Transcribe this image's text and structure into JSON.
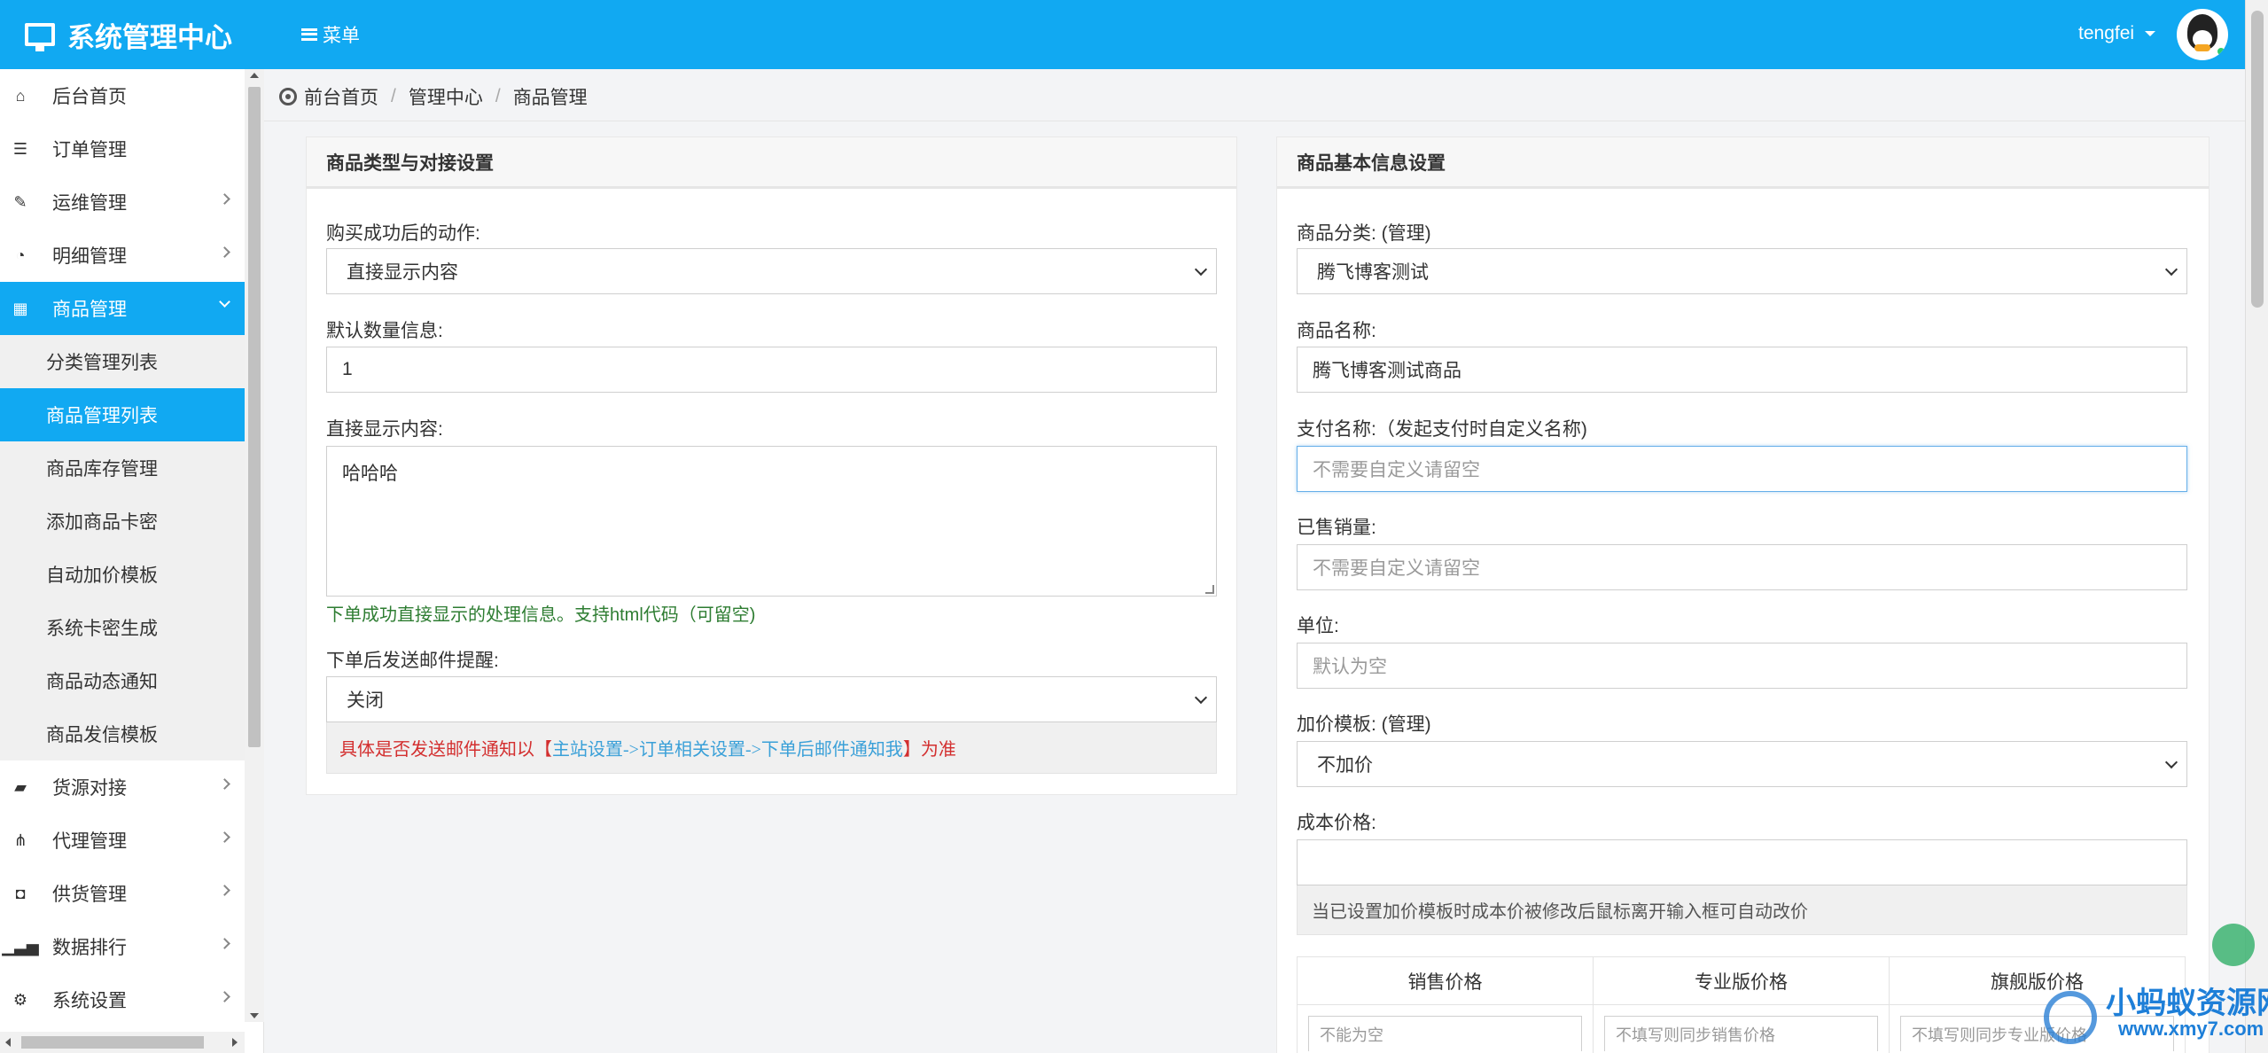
{
  "app": {
    "title": "系统管理中心",
    "menu_label": "菜单",
    "user": "tengfei"
  },
  "colors": {
    "primary": "#11a9f2",
    "help_green": "#2e7d32",
    "warn_red": "#d32f2f",
    "link_blue": "#3aa0d8"
  },
  "sidebar": {
    "items": [
      {
        "label": "后台首页",
        "icon": "home-icon"
      },
      {
        "label": "订单管理",
        "icon": "list-icon"
      },
      {
        "label": "运维管理",
        "icon": "comments-icon"
      },
      {
        "label": "明细管理",
        "icon": "pie-chart-icon"
      },
      {
        "label": "商品管理",
        "icon": "grid-icon"
      },
      {
        "label": "货源对接",
        "icon": "briefcase-icon"
      },
      {
        "label": "代理管理",
        "icon": "sitemap-icon"
      },
      {
        "label": "供货管理",
        "icon": "shopping-bag-icon"
      },
      {
        "label": "数据排行",
        "icon": "signal-icon"
      },
      {
        "label": "系统设置",
        "icon": "cogs-icon"
      }
    ],
    "sub_items": [
      "分类管理列表",
      "商品管理列表",
      "商品库存管理",
      "添加商品卡密",
      "自动加价模板",
      "系统卡密生成",
      "商品动态通知",
      "商品发信模板"
    ]
  },
  "breadcrumb": [
    "前台首页",
    "管理中心",
    "商品管理"
  ],
  "left_panel": {
    "title": "商品类型与对接设置",
    "action_label": "购买成功后的动作:",
    "action_value": "直接显示内容",
    "qty_label": "默认数量信息:",
    "qty_value": "1",
    "content_label": "直接显示内容:",
    "content_value": "哈哈哈",
    "content_help": "下单成功直接显示的处理信息。支持html代码（可留空)",
    "mail_label": "下单后发送邮件提醒:",
    "mail_value": "关闭",
    "mail_note_prefix": "具体是否发送邮件通知以【",
    "mail_note_link": "主站设置->订单相关设置->下单后邮件通知我",
    "mail_note_suffix": "】为准"
  },
  "right_panel": {
    "title": "商品基本信息设置",
    "category_label": "商品分类: (管理)",
    "category_value": "腾飞博客测试",
    "name_label": "商品名称:",
    "name_value": "腾飞博客测试商品",
    "pay_name_label": "支付名称:（发起支付时自定义名称)",
    "pay_name_placeholder": "不需要自定义请留空",
    "sold_label": "已售销量:",
    "sold_placeholder": "不需要自定义请留空",
    "unit_label": "单位:",
    "unit_placeholder": "默认为空",
    "markup_label": "加价模板: (管理)",
    "markup_value": "不加价",
    "cost_label": "成本价格:",
    "cost_value": "",
    "cost_note": "当已设置加价模板时成本价被修改后鼠标离开输入框可自动改价",
    "price_headers": [
      "销售价格",
      "专业版价格",
      "旗舰版价格"
    ],
    "price_placeholders": [
      "不能为空",
      "不填写则同步销售价格",
      "不填写则同步专业版价格"
    ]
  },
  "watermark": {
    "brand": "小蚂蚁资源网",
    "site": "www.xmy7.com"
  }
}
